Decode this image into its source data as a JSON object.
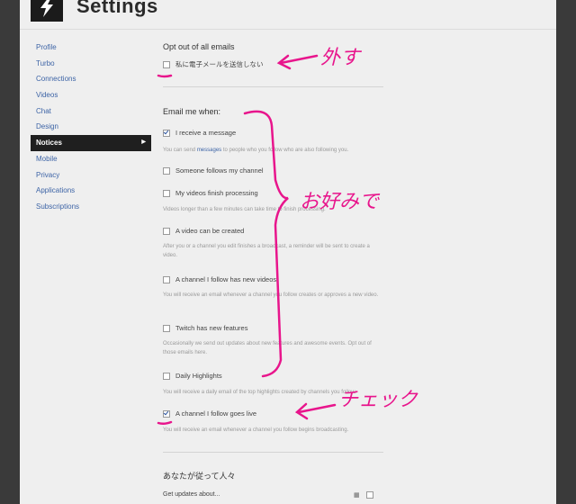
{
  "header": {
    "title": "Settings"
  },
  "sidebar": {
    "items": [
      {
        "label": "Profile"
      },
      {
        "label": "Turbo"
      },
      {
        "label": "Connections"
      },
      {
        "label": "Videos"
      },
      {
        "label": "Chat"
      },
      {
        "label": "Design"
      },
      {
        "label": "Notices",
        "active": true
      },
      {
        "label": "Mobile"
      },
      {
        "label": "Privacy"
      },
      {
        "label": "Applications"
      },
      {
        "label": "Subscriptions"
      }
    ]
  },
  "optout": {
    "title": "Opt out of all emails",
    "checkbox_label": "私に電子メールを送信しない",
    "checked": false
  },
  "email_me": {
    "title": "Email me when:",
    "options": [
      {
        "label": "I receive a message",
        "checked": true,
        "desc_pre": "You can send ",
        "desc_link": "messages",
        "desc_post": " to people who you follow who are also following you."
      },
      {
        "label": "Someone follows my channel",
        "checked": false,
        "desc": ""
      },
      {
        "label": "My videos finish processing",
        "checked": false,
        "desc": "Videos longer than a few minutes can take time to finish processing."
      },
      {
        "label": "A video can be created",
        "checked": false,
        "desc": "After you or a channel you edit finishes a broadcast, a reminder will be sent to create a video."
      },
      {
        "label": "A channel I follow has new videos",
        "checked": false,
        "desc": "You will receive an email whenever a channel you follow creates or approves a new video."
      },
      {
        "label": "Twitch has new features",
        "checked": false,
        "desc": "Occasionally we send out updates about new features and awesome events. Opt out of those emails here."
      },
      {
        "label": "Daily Highlights",
        "checked": false,
        "desc": "You will receive a daily email of the top highlights created by channels you follow."
      },
      {
        "label": "A channel I follow goes live",
        "checked": true,
        "desc": "You will receive an email whenever a channel you follow begins broadcasting."
      }
    ]
  },
  "following": {
    "title": "あなたが従って人々",
    "row_label": "Get updates about..."
  },
  "annotations": {
    "remove": "外す",
    "preference": "お好みで",
    "check": "チェック",
    "color": "#e8158c"
  }
}
